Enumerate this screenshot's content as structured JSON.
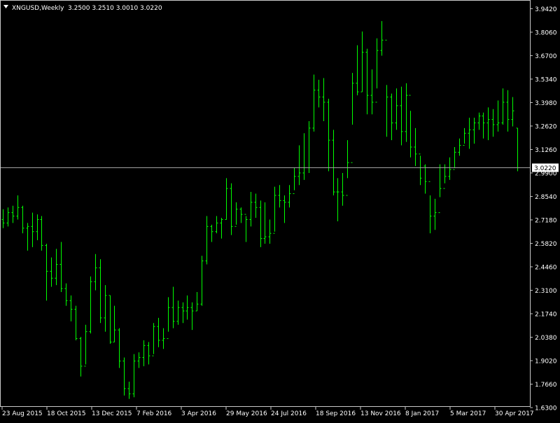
{
  "header": {
    "symbol_timeframe": "XNGUSD,Weekly",
    "ohlc": "3.2500 3.2510 3.0010 3.0220"
  },
  "colors": {
    "background": "#000000",
    "frame": "#c8c8c8",
    "bar": "#00ff00",
    "text": "#ffffff",
    "price_line": "#a0a0a0",
    "price_tag_bg": "#ffffff",
    "price_tag_text": "#000000"
  },
  "icons": {
    "menu_toggle": "triangle-down-icon"
  },
  "chart_data": {
    "type": "ohlc",
    "timeframe": "Weekly",
    "symbol": "XNGUSD",
    "current_price": "3.0220",
    "ylim": [
      1.63,
      3.96
    ],
    "y_tick_labels": [
      "3.9420",
      "3.8060",
      "3.6700",
      "3.5340",
      "3.3980",
      "3.2620",
      "3.1260",
      "2.9900",
      "2.8540",
      "2.7180",
      "2.5820",
      "2.4460",
      "2.3100",
      "2.1740",
      "2.0380",
      "1.9020",
      "1.7660",
      "1.6300"
    ],
    "x_tick_labels": [
      "23 Aug 2015",
      "18 Oct 2015",
      "13 Dec 2015",
      "7 Feb 2016",
      "3 Apr 2016",
      "29 May 2016",
      "24 Jul 2016",
      "18 Sep 2016",
      "13 Nov 2016",
      "8 Jan 2017",
      "5 Mar 2017",
      "30 Apr 2017"
    ],
    "grid": false,
    "bars": [
      [
        2.72,
        2.78,
        2.67,
        2.7
      ],
      [
        2.7,
        2.79,
        2.68,
        2.76
      ],
      [
        2.76,
        2.8,
        2.7,
        2.74
      ],
      [
        2.74,
        2.86,
        2.72,
        2.79
      ],
      [
        2.79,
        2.8,
        2.64,
        2.67
      ],
      [
        2.67,
        2.7,
        2.54,
        2.68
      ],
      [
        2.68,
        2.76,
        2.56,
        2.65
      ],
      [
        2.65,
        2.75,
        2.6,
        2.72
      ],
      [
        2.72,
        2.74,
        2.54,
        2.57
      ],
      [
        2.57,
        2.58,
        2.25,
        2.42
      ],
      [
        2.42,
        2.5,
        2.33,
        2.38
      ],
      [
        2.38,
        2.55,
        2.34,
        2.46
      ],
      [
        2.46,
        2.59,
        2.3,
        2.32
      ],
      [
        2.32,
        2.35,
        2.22,
        2.25
      ],
      [
        2.25,
        2.28,
        2.13,
        2.2
      ],
      [
        2.2,
        2.22,
        2.02,
        2.03
      ],
      [
        2.03,
        2.04,
        1.81,
        1.87
      ],
      [
        1.87,
        2.11,
        1.88,
        2.07
      ],
      [
        2.07,
        2.39,
        2.06,
        2.36
      ],
      [
        2.36,
        2.52,
        2.31,
        2.44
      ],
      [
        2.44,
        2.49,
        2.12,
        2.15
      ],
      [
        2.15,
        2.34,
        2.07,
        2.28
      ],
      [
        2.28,
        2.28,
        2.0,
        2.01
      ],
      [
        2.01,
        2.22,
        2.01,
        2.08
      ],
      [
        2.08,
        2.09,
        1.86,
        1.9
      ],
      [
        1.9,
        1.92,
        1.7,
        1.74
      ],
      [
        1.74,
        1.78,
        1.68,
        1.71
      ],
      [
        1.71,
        1.94,
        1.69,
        1.9
      ],
      [
        1.9,
        1.95,
        1.86,
        1.92
      ],
      [
        1.92,
        2.02,
        1.87,
        1.99
      ],
      [
        1.99,
        2.01,
        1.88,
        1.93
      ],
      [
        1.93,
        2.12,
        1.94,
        2.1
      ],
      [
        2.1,
        2.15,
        1.98,
        2.02
      ],
      [
        2.02,
        2.09,
        1.97,
        2.03
      ],
      [
        2.03,
        2.27,
        2.07,
        2.21
      ],
      [
        2.21,
        2.33,
        2.09,
        2.13
      ],
      [
        2.13,
        2.25,
        2.11,
        2.21
      ],
      [
        2.21,
        2.24,
        2.12,
        2.19
      ],
      [
        2.19,
        2.28,
        2.14,
        2.21
      ],
      [
        2.21,
        2.24,
        2.08,
        2.19
      ],
      [
        2.19,
        2.3,
        2.19,
        2.23
      ],
      [
        2.23,
        2.51,
        2.22,
        2.48
      ],
      [
        2.48,
        2.74,
        2.46,
        2.68
      ],
      [
        2.68,
        2.69,
        2.59,
        2.65
      ],
      [
        2.65,
        2.74,
        2.64,
        2.7
      ],
      [
        2.7,
        2.73,
        2.61,
        2.72
      ],
      [
        2.72,
        2.96,
        2.72,
        2.9
      ],
      [
        2.9,
        2.93,
        2.63,
        2.68
      ],
      [
        2.68,
        2.82,
        2.69,
        2.78
      ],
      [
        2.78,
        2.79,
        2.7,
        2.75
      ],
      [
        2.75,
        2.74,
        2.59,
        2.72
      ],
      [
        2.72,
        2.88,
        2.68,
        2.82
      ],
      [
        2.82,
        2.87,
        2.73,
        2.79
      ],
      [
        2.79,
        2.83,
        2.56,
        2.61
      ],
      [
        2.61,
        2.82,
        2.58,
        2.62
      ],
      [
        2.62,
        2.72,
        2.58,
        2.64
      ],
      [
        2.64,
        2.91,
        2.65,
        2.86
      ],
      [
        2.86,
        2.92,
        2.79,
        2.83
      ],
      [
        2.83,
        2.86,
        2.7,
        2.82
      ],
      [
        2.82,
        2.92,
        2.79,
        2.87
      ],
      [
        2.87,
        3.02,
        2.89,
        2.97
      ],
      [
        2.97,
        3.15,
        2.92,
        2.99
      ],
      [
        2.99,
        3.22,
        2.95,
        3.02
      ],
      [
        3.02,
        3.29,
        2.99,
        3.25
      ],
      [
        3.25,
        3.56,
        3.23,
        3.47
      ],
      [
        3.47,
        3.53,
        3.37,
        3.43
      ],
      [
        3.43,
        3.54,
        3.29,
        3.4
      ],
      [
        3.4,
        3.42,
        3.0,
        3.18
      ],
      [
        3.18,
        3.24,
        2.86,
        2.88
      ],
      [
        2.88,
        2.96,
        2.71,
        2.88
      ],
      [
        2.88,
        2.99,
        2.8,
        2.86
      ],
      [
        2.86,
        3.18,
        2.96,
        3.05
      ],
      [
        3.05,
        3.57,
        3.27,
        3.51
      ],
      [
        3.51,
        3.73,
        3.44,
        3.46
      ],
      [
        3.46,
        3.81,
        3.46,
        3.69
      ],
      [
        3.69,
        3.71,
        3.33,
        3.44
      ],
      [
        3.44,
        3.59,
        3.33,
        3.4
      ],
      [
        3.4,
        3.77,
        3.48,
        3.7
      ],
      [
        3.7,
        3.87,
        3.67,
        3.76
      ],
      [
        3.76,
        3.5,
        3.2,
        3.43
      ],
      [
        3.43,
        3.45,
        3.18,
        3.28
      ],
      [
        3.28,
        3.48,
        3.24,
        3.38
      ],
      [
        3.38,
        3.49,
        3.15,
        3.23
      ],
      [
        3.23,
        3.51,
        3.17,
        3.44
      ],
      [
        3.44,
        3.35,
        3.08,
        3.14
      ],
      [
        3.14,
        3.25,
        3.03,
        3.1
      ],
      [
        3.1,
        3.09,
        2.92,
        2.96
      ],
      [
        3.03,
        3.04,
        2.87,
        2.94
      ],
      [
        2.94,
        2.86,
        2.64,
        2.74
      ],
      [
        2.74,
        2.84,
        2.66,
        2.76
      ],
      [
        2.76,
        3.04,
        2.85,
        2.9
      ],
      [
        2.9,
        3.04,
        2.93,
        2.97
      ],
      [
        2.97,
        3.08,
        2.95,
        3.01
      ],
      [
        3.01,
        3.14,
        3.02,
        3.11
      ],
      [
        3.11,
        3.19,
        3.09,
        3.15
      ],
      [
        3.15,
        3.25,
        3.16,
        3.22
      ],
      [
        3.22,
        3.31,
        3.13,
        3.24
      ],
      [
        3.24,
        3.31,
        3.16,
        3.28
      ],
      [
        3.28,
        3.34,
        3.24,
        3.32
      ],
      [
        3.32,
        3.34,
        3.19,
        3.28
      ],
      [
        3.28,
        3.37,
        3.18,
        3.3
      ],
      [
        3.3,
        3.36,
        3.2,
        3.27
      ],
      [
        3.27,
        3.41,
        3.23,
        3.28
      ],
      [
        3.28,
        3.48,
        3.27,
        3.4
      ],
      [
        3.4,
        3.47,
        3.23,
        3.3
      ],
      [
        3.3,
        3.43,
        3.26,
        3.35
      ],
      [
        3.25,
        3.25,
        3.0,
        3.02
      ]
    ]
  }
}
